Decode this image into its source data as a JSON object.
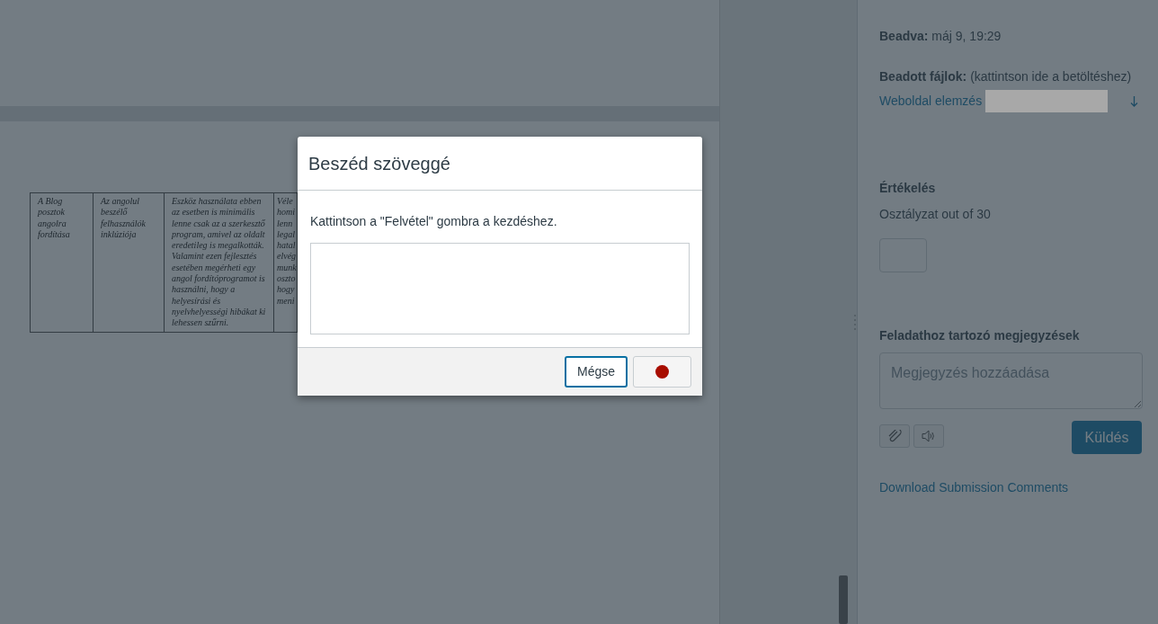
{
  "document": {
    "table": {
      "rows": [
        {
          "cells": [
            {
              "text": "A Blog posztok angolra fordítása"
            },
            {
              "text": "Az angolul beszélő felhasználók inklúziója"
            },
            {
              "text": "Eszköz használata ebben az esetben is minimális lenne csak az a szerkesztő program, amivel az oldalt eredetileg is megalkották. Valamint ezen fejlesztés esetében megérheti egy angol fordítóprogramot is használni, hogy a helyesírási és nyelvhelyességi hibákat ki lehessen szűrni."
            },
            {
              "lines": [
                "Véle",
                "homi",
                "lenn",
                "legal",
                "hatal",
                "elvég",
                "munk",
                "oszto",
                "hogy",
                "meni"
              ]
            }
          ]
        }
      ]
    }
  },
  "sidebar": {
    "submitted": {
      "label": "Beadva:",
      "value": "máj 9, 19:29"
    },
    "files": {
      "label": "Beadott fájlok:",
      "value": "(kattintson ide a betöltéshez)",
      "items": [
        {
          "name": "Weboldal elemzés",
          "redacted": true
        }
      ]
    },
    "grading": {
      "heading": "Értékelés",
      "label": "Osztályzat out of 30"
    },
    "comments": {
      "heading": "Feladathoz tartozó megjegyzések",
      "placeholder": "Megjegyzés hozzáadása",
      "send": "Küldés",
      "download": "Download Submission Comments"
    }
  },
  "modal": {
    "title": "Beszéd szöveggé",
    "instruction": "Kattintson a \"Felvétel\" gombra a kezdéshez.",
    "buttons": [
      {
        "kind": "text",
        "label": "Mégse",
        "focused": true
      },
      {
        "kind": "record",
        "focused": false
      }
    ]
  }
}
